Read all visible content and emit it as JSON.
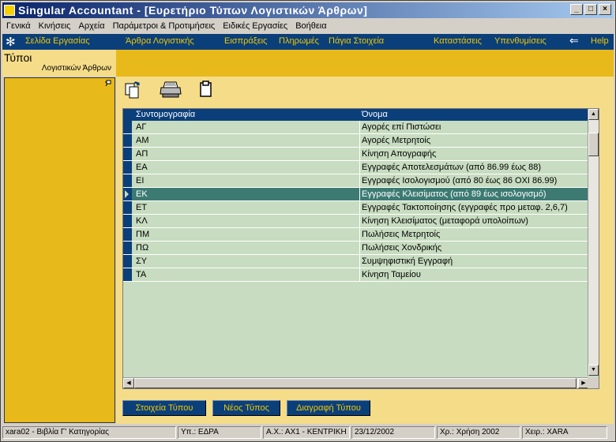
{
  "window": {
    "title": "Singular Accountant - [Ευρετήριο Τύπων Λογιστικών Άρθρων]",
    "controls": {
      "minimize": "_",
      "maximize": "□",
      "close": "×"
    }
  },
  "menu": {
    "items": [
      "Γενικά",
      "Κινήσεις",
      "Αρχεία",
      "Παράμετροι & Προτιμήσεις",
      "Ειδικές Εργασίες",
      "Βοήθεια"
    ]
  },
  "nav": {
    "items": [
      "Σελίδα Εργασίας",
      "Άρθρα Λογιστικής",
      "Εισπράξεις",
      "Πληρωμές",
      "Πάγια Στοιχεία",
      "Καταστάσεις",
      "Υπενθυμίσεις",
      "Help"
    ],
    "accent": "#0b3f7a",
    "text_color": "#f0c800"
  },
  "left_pane": {
    "title": "Τύποι",
    "subtitle": "Λογιστικών Άρθρων"
  },
  "toolbar": {
    "icons": [
      "new-document-icon",
      "print-icon",
      "clipboard-icon"
    ]
  },
  "grid": {
    "columns": [
      "Συντομογραφία",
      "Όνομα"
    ],
    "selected_index": 5,
    "rows": [
      {
        "code": "ΑΓ",
        "name": "Αγορές επί Πιστώσει"
      },
      {
        "code": "ΑΜ",
        "name": "Αγορές Μετρητοίς"
      },
      {
        "code": "ΑΠ",
        "name": "Κίνηση Απογραφής"
      },
      {
        "code": "ΕΑ",
        "name": "Εγγραφές Αποτελεσμάτων (από 86.99 έως 88)"
      },
      {
        "code": "ΕΙ",
        "name": "Εγγραφές Ισολογισμού (από 80 έως 86 ΟΧΙ 86.99)"
      },
      {
        "code": "ΕΚ",
        "name": "Εγγραφές Κλεισίματος (από 89 έως ισολογισμό)"
      },
      {
        "code": "ΕΤ",
        "name": "Εγγραφές Τακτοποίησης (εγγραφές προ μεταφ. 2,6,7)"
      },
      {
        "code": "ΚΛ",
        "name": "Κίνηση Κλεισίματος (μεταφορά υπολοίπων)"
      },
      {
        "code": "ΠΜ",
        "name": "Πωλήσεις Μετρητοίς"
      },
      {
        "code": "ΠΩ",
        "name": "Πωλήσεις Χονδρικής"
      },
      {
        "code": "ΣΥ",
        "name": "Συμψηφιστική Εγγραφή"
      },
      {
        "code": "ΤΑ",
        "name": "Κίνηση Ταμείου"
      }
    ]
  },
  "buttons": {
    "details": "Στοιχεία Τύπου",
    "new": "Νέος Τύπος",
    "delete": "Διαγραφή Τύπου"
  },
  "status": {
    "company": "xara02 - Βιβλία Γ' Κατηγορίας",
    "branch": "Υπ.: ΕΔΡΑ",
    "warehouse": "Α.Χ.: ΑΧ1 - ΚΕΝΤΡΙΚΗ",
    "date": "23/12/2002",
    "fiscal_year": "Χρ.: Χρήση 2002",
    "user": "Χειρ.: XARA"
  }
}
